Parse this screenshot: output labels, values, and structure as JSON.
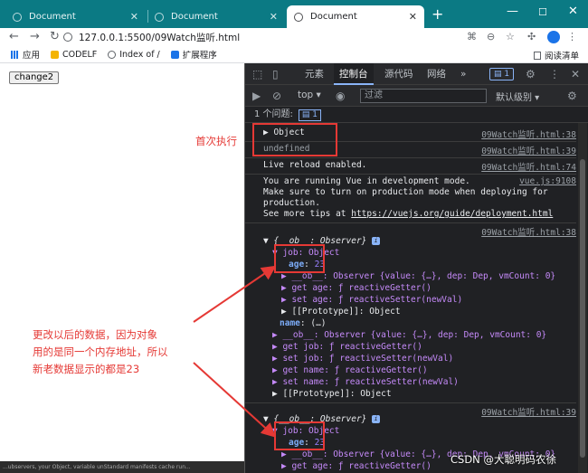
{
  "browser": {
    "tabs": [
      {
        "title": "Document",
        "active": false
      },
      {
        "title": "Document",
        "active": false
      },
      {
        "title": "Document",
        "active": true
      }
    ],
    "new_tab": "+",
    "window_controls": {
      "minimize": "—",
      "maximize": "☐",
      "close": "✕"
    },
    "url": "127.0.0.1:5500/09Watch监听.html",
    "bookmarks": [
      {
        "label": "应用",
        "icon": "apps-grid-icon"
      },
      {
        "label": "CODELF",
        "icon": "codelf-icon"
      },
      {
        "label": "Index of /",
        "icon": "globe-icon"
      },
      {
        "label": "扩展程序",
        "icon": "puzzle-icon"
      }
    ],
    "reading_list": "阅读清单"
  },
  "page": {
    "button_label": "change2",
    "bottom_strip_text": "...ubservers, your Object, variable unStandard manifests cache run..."
  },
  "devtools": {
    "tabs": [
      "元素",
      "控制台",
      "源代码",
      "网络",
      "»"
    ],
    "active_tab": "控制台",
    "message_count": "1",
    "context": "top ▾",
    "filter_placeholder": "过滤",
    "level": "默认级别 ▾",
    "issues_label": "1 个问题:",
    "issues_count": "1",
    "console": {
      "log1_object": "▶ Object",
      "log1_src": "09Watch监听.html:38",
      "log2_undefined": "undefined",
      "log2_src": "09Watch监听.html:39",
      "reload": "Live reload enabled.",
      "reload_src": "09Watch监听.html:74",
      "vue_line1": "You are running Vue in development mode.",
      "vue_src": "vue.js:9108",
      "vue_line2": "Make sure to turn on production mode when deploying for",
      "vue_line3": "production.",
      "vue_line4_prefix": "See more tips at ",
      "vue_line4_link": "https://vuejs.org/guide/deployment.html",
      "block1_src": "09Watch监听.html:38",
      "observer_line": "▼ {__ob__: Observer} ",
      "job_line": "▼ job: Object",
      "age_key": "age",
      "age_value": "23",
      "job_ob_line": "▶ __ob__: Observer {value: {…}, dep: Dep, vmCount: 0}",
      "get_age": "▶ get age: ƒ reactiveGetter()",
      "set_age": "▶ set age: ƒ reactiveSetter(newVal)",
      "proto_obj": "▶ [[Prototype]]: Object",
      "name_key": "name",
      "name_value": "(…)",
      "root_ob_line": "▶ __ob__: Observer {value: {…}, dep: Dep, vmCount: 0}",
      "get_job": "▶ get job: ƒ reactiveGetter()",
      "set_job": "▶ set job: ƒ reactiveSetter(newVal)",
      "get_name": "▶ get name: ƒ reactiveGetter()",
      "set_name": "▶ set name: ƒ reactiveSetter(newVal)",
      "root_proto": "▶ [[Prototype]]: Object",
      "block2_src": "09Watch监听.html:39",
      "observer_line2": "▼ {__ob__: Observer} ",
      "job_line2": "▼ job: Object",
      "age_value2": "23",
      "job_ob_line2": "▶ __ob__: Observer {value: {…}, dep: Dep, vmCount: 0}",
      "get_age2": "▶ get age: ƒ reactiveGetter()"
    }
  },
  "annotations": {
    "first_exec": "首次执行",
    "explanation": [
      "更改以后的数据，因为对象",
      "用的是同一个内存地址，所以",
      "新老数据显示的都是23"
    ],
    "color": "#e53935"
  },
  "watermark": "CSDN @大聪明码农徐"
}
